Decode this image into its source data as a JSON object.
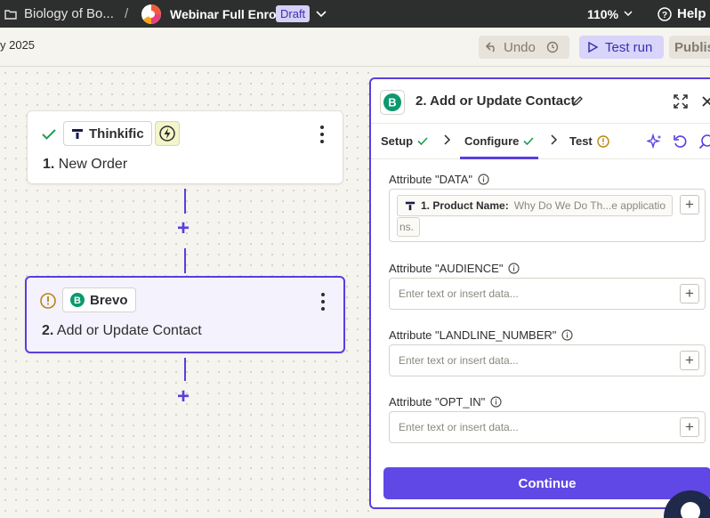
{
  "topbar": {
    "folder": "Biology of Bo...",
    "separator": "/",
    "zap_name": "Webinar Full Enrol",
    "status_badge": "Draft",
    "zoom": "110%",
    "help": "Help"
  },
  "subbar": {
    "date_label": "y 2025",
    "undo": "Undo",
    "test_run": "Test run",
    "publish": "Publis"
  },
  "canvas": {
    "step1": {
      "app": "Thinkific",
      "number": "1.",
      "title": "New Order"
    },
    "step2": {
      "app": "Brevo",
      "number": "2.",
      "title": "Add or Update Contact"
    },
    "plus": "+"
  },
  "panel": {
    "title": "2. Add or Update Contact",
    "tabs": [
      {
        "label": "Setup",
        "status": "complete"
      },
      {
        "label": "Configure",
        "status": "complete"
      },
      {
        "label": "Test",
        "status": "warning"
      }
    ],
    "fields": [
      {
        "label": "Attribute \"DATA\"",
        "pill_label": "1. Product Name:",
        "pill_value": "Why Do We Do Th...e applicatio",
        "pill_overflow": "ns."
      },
      {
        "label": "Attribute \"AUDIENCE\"",
        "placeholder": "Enter text or insert data..."
      },
      {
        "label": "Attribute \"LANDLINE_NUMBER\"",
        "placeholder": "Enter text or insert data..."
      },
      {
        "label": "Attribute \"OPT_IN\"",
        "placeholder": "Enter text or insert data..."
      }
    ],
    "continue": "Continue"
  },
  "colors": {
    "accent": "#5a3ee0",
    "topbar_bg": "#2d2e2e",
    "success": "#1f9d55",
    "warning": "#b7860b",
    "brevo_green": "#0b996e"
  }
}
